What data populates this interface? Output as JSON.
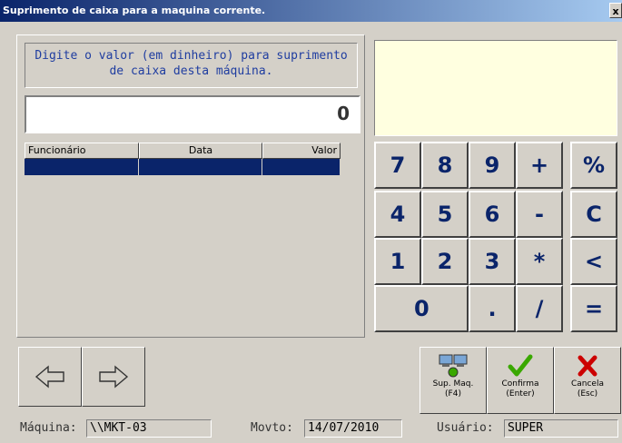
{
  "window": {
    "title": "Suprimento de caixa para a maquina corrente.",
    "close_label": "x"
  },
  "instruction": "Digite o valor (em dinheiro) para suprimento de caixa desta máquina.",
  "amount_value": "0",
  "grid": {
    "headers": [
      "Funcionário",
      "Data",
      "Valor"
    ],
    "rows": [
      [
        "",
        "",
        ""
      ]
    ]
  },
  "keypad": {
    "keys": [
      "7",
      "8",
      "9",
      "+",
      "%",
      "4",
      "5",
      "6",
      "-",
      "C",
      "1",
      "2",
      "3",
      "*",
      "<",
      "0",
      ".",
      "/",
      "="
    ]
  },
  "icons": {
    "prev": "arrow-left-icon",
    "next": "arrow-right-icon",
    "sup": "computers-icon",
    "confirm": "checkmark-icon",
    "cancel": "x-mark-icon"
  },
  "actions": {
    "sup_maq": {
      "line1": "Sup. Maq.",
      "line2": "(F4)"
    },
    "confirma": {
      "line1": "Confirma",
      "line2": "(Enter)"
    },
    "cancela": {
      "line1": "Cancela",
      "line2": "(Esc)"
    }
  },
  "status": {
    "maquina_label": "Máquina:",
    "maquina_value": "\\\\MKT-03",
    "movto_label": "Movto:",
    "movto_value": "14/07/2010",
    "usuario_label": "Usuário:",
    "usuario_value": "SUPER"
  },
  "colors": {
    "accent": "#0a246a",
    "display_bg": "#ffffe0",
    "confirm": "#3aa800",
    "cancel": "#cc0000"
  }
}
